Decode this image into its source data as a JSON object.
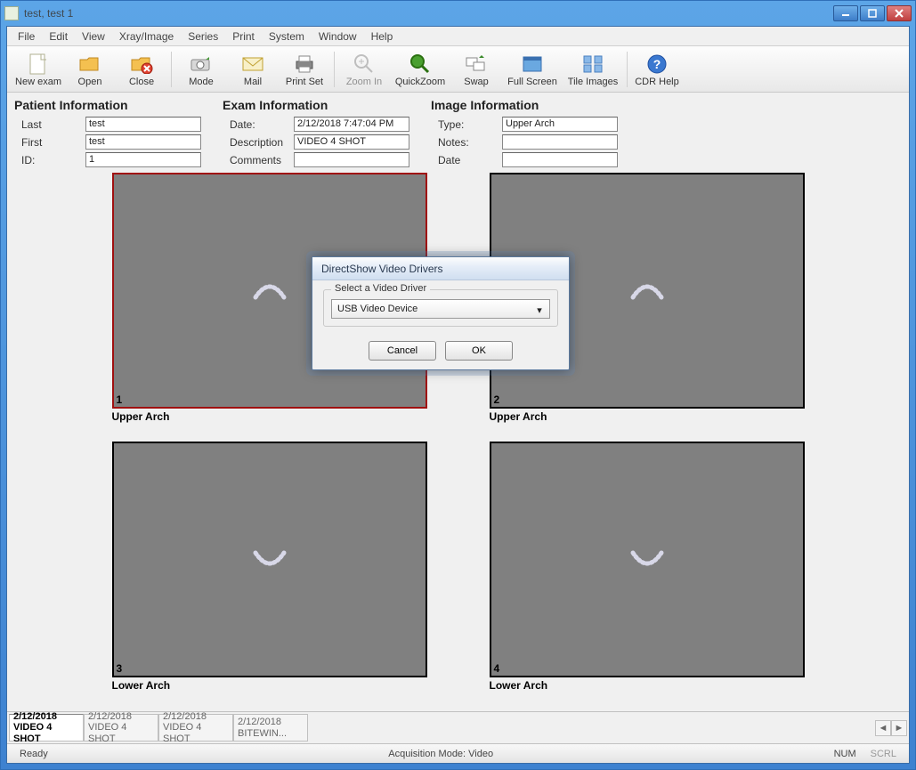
{
  "window": {
    "title": "test, test 1"
  },
  "menu": {
    "items": [
      "File",
      "Edit",
      "View",
      "Xray/Image",
      "Series",
      "Print",
      "System",
      "Window",
      "Help"
    ]
  },
  "toolbar": {
    "new_exam": "New exam",
    "open": "Open",
    "close": "Close",
    "mode": "Mode",
    "mail": "Mail",
    "print_set": "Print Set",
    "zoom_in": "Zoom In",
    "quick_zoom": "QuickZoom",
    "swap": "Swap",
    "full_screen": "Full Screen",
    "tile_images": "Tile Images",
    "cdr_help": "CDR Help"
  },
  "patient": {
    "title": "Patient Information",
    "last_label": "Last",
    "last": "test",
    "first_label": "First",
    "first": "test",
    "id_label": "ID:",
    "id": "1"
  },
  "exam": {
    "title": "Exam Information",
    "date_label": "Date:",
    "date": "2/12/2018 7:47:04 PM",
    "desc_label": "Description",
    "desc": "VIDEO 4 SHOT",
    "comments_label": "Comments",
    "comments": ""
  },
  "image": {
    "title": "Image Information",
    "type_label": "Type:",
    "type": "Upper Arch",
    "notes_label": "Notes:",
    "notes": "",
    "date_label": "Date",
    "date": ""
  },
  "cells": {
    "c1": {
      "num": "1",
      "caption": "Upper Arch"
    },
    "c2": {
      "num": "2",
      "caption": "Upper Arch"
    },
    "c3": {
      "num": "3",
      "caption": "Lower Arch"
    },
    "c4": {
      "num": "4",
      "caption": "Lower Arch"
    }
  },
  "tabs": {
    "t0": {
      "date": "2/12/2018",
      "name": "VIDEO 4 SHOT"
    },
    "t1": {
      "date": "2/12/2018",
      "name": "VIDEO 4 SHOT"
    },
    "t2": {
      "date": "2/12/2018",
      "name": "VIDEO 4 SHOT"
    },
    "t3": {
      "date": "2/12/2018",
      "name": "BITEWIN..."
    }
  },
  "status": {
    "ready": "Ready",
    "mode": "Acquisition Mode: Video",
    "num": "NUM",
    "scrl": "SCRL"
  },
  "dialog": {
    "title": "DirectShow Video Drivers",
    "group": "Select a Video Driver",
    "selected": "USB Video Device",
    "cancel": "Cancel",
    "ok": "OK"
  }
}
